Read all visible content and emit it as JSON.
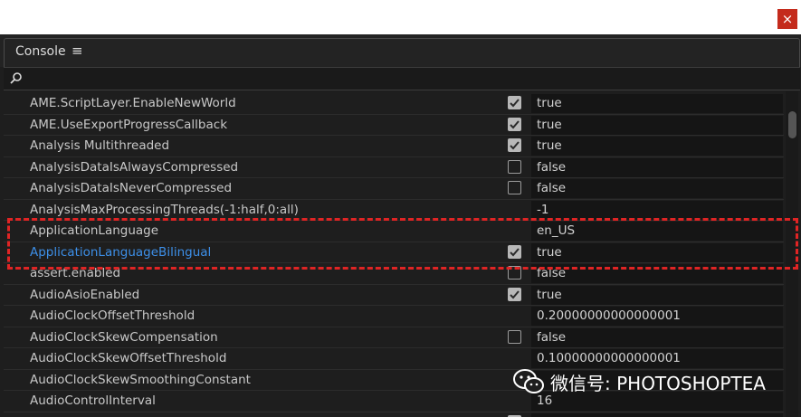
{
  "window": {
    "close_glyph": "×"
  },
  "panel": {
    "tab_label": "Console",
    "tab_menu_glyph": "≡"
  },
  "search": {
    "value": ""
  },
  "rows": [
    {
      "name": "AME.ScriptLayer.EnableNewWorld",
      "checkbox": "checked",
      "value": "true"
    },
    {
      "name": "AME.UseExportProgressCallback",
      "checkbox": "checked",
      "value": "true"
    },
    {
      "name": "Analysis Multithreaded",
      "checkbox": "checked",
      "value": "true"
    },
    {
      "name": "AnalysisDataIsAlwaysCompressed",
      "checkbox": "unchecked",
      "value": "false"
    },
    {
      "name": "AnalysisDataIsNeverCompressed",
      "checkbox": "unchecked",
      "value": "false"
    },
    {
      "name": "AnalysisMaxProcessingThreads(-1:half,0:all)",
      "checkbox": "none",
      "value": "-1"
    },
    {
      "name": "ApplicationLanguage",
      "checkbox": "none",
      "value": "en_US"
    },
    {
      "name": "ApplicationLanguageBilingual",
      "checkbox": "checked",
      "value": "true",
      "active": true
    },
    {
      "name": "assert.enabled",
      "checkbox": "unchecked",
      "value": "false"
    },
    {
      "name": "AudioAsioEnabled",
      "checkbox": "checked",
      "value": "true"
    },
    {
      "name": "AudioClockOffsetThreshold",
      "checkbox": "none",
      "value": "0.20000000000000001"
    },
    {
      "name": "AudioClockSkewCompensation",
      "checkbox": "unchecked",
      "value": "false"
    },
    {
      "name": "AudioClockSkewOffsetThreshold",
      "checkbox": "none",
      "value": "0.10000000000000001"
    },
    {
      "name": "AudioClockSkewSmoothingConstant",
      "checkbox": "none",
      "value": ""
    },
    {
      "name": "AudioControlInterval",
      "checkbox": "none",
      "value": "16"
    },
    {
      "name": "",
      "checkbox": "checked",
      "value": ""
    }
  ],
  "watermark": {
    "text": "微信号: PHOTOSHOPTEA"
  },
  "colors": {
    "panel_bg": "#1e1e1e",
    "active_name": "#3d8fe8",
    "highlight": "#e02424",
    "close_button": "#c42b1c"
  }
}
